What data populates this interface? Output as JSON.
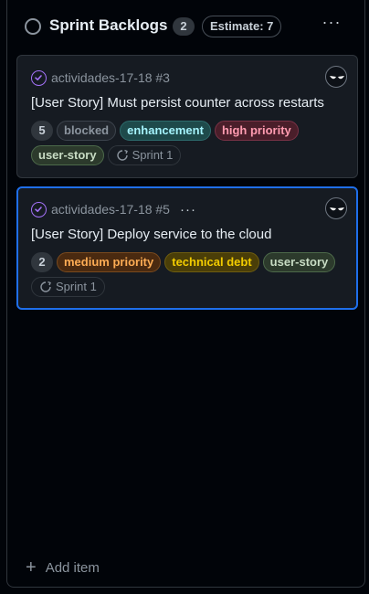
{
  "column": {
    "title": "Sprint Backlogs",
    "count": "2",
    "estimate": "Estimate: 7",
    "menu_label": "···",
    "add_item_label": "Add item"
  },
  "cards": [
    {
      "repo": "actividades-17-18 #3",
      "title": "[User Story] Must persist counter across restarts",
      "estimate": "5",
      "labels": [
        "blocked",
        "enhancement",
        "high priority",
        "user-story"
      ],
      "iteration": "Sprint 1"
    },
    {
      "repo": "actividades-17-18 #5",
      "menu_label": "···",
      "title": "[User Story] Deploy service to the cloud",
      "estimate": "2",
      "labels": [
        "medium priority",
        "technical debt",
        "user-story"
      ],
      "iteration": "Sprint 1"
    }
  ],
  "icons": {
    "status": "circle-outline-icon",
    "issue": "issue-check-icon",
    "avatar": "avatar-icon",
    "iteration": "iteration-icon",
    "add": "plus-icon"
  },
  "colors": {
    "selected_border": "#1f6feb",
    "issue_accent": "#a371f7"
  }
}
